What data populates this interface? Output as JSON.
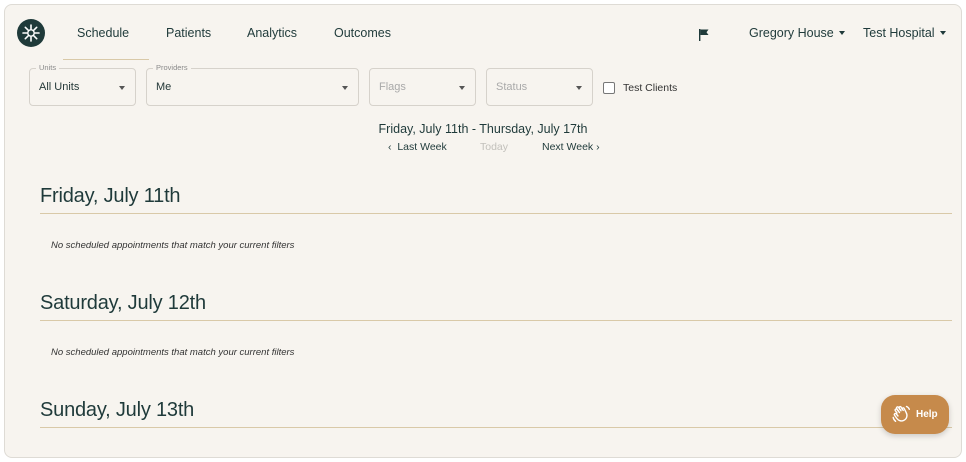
{
  "nav": {
    "links": [
      "Schedule",
      "Patients",
      "Analytics",
      "Outcomes"
    ],
    "active": "Schedule",
    "user": "Gregory House",
    "hospital": "Test Hospital"
  },
  "filters": {
    "units": {
      "legend": "Units",
      "value": "All Units"
    },
    "providers": {
      "legend": "Providers",
      "value": "Me"
    },
    "flags": {
      "placeholder": "Flags"
    },
    "status": {
      "placeholder": "Status"
    },
    "test_clients_label": "Test Clients"
  },
  "week": {
    "range": "Friday, July 11th - Thursday, July 17th",
    "last_week": "Last Week",
    "today": "Today",
    "next_week": "Next Week"
  },
  "days": [
    {
      "title": "Friday, July 11th",
      "empty": "No scheduled appointments that match your current filters"
    },
    {
      "title": "Saturday, July 12th",
      "empty": "No scheduled appointments that match your current filters"
    },
    {
      "title": "Sunday, July 13th",
      "empty": ""
    }
  ],
  "help": {
    "label": "Help"
  },
  "colors": {
    "accent": "#c68a4b",
    "rule": "#d9c9a8",
    "text": "#1f3a3a",
    "background": "#f7f4ef"
  }
}
